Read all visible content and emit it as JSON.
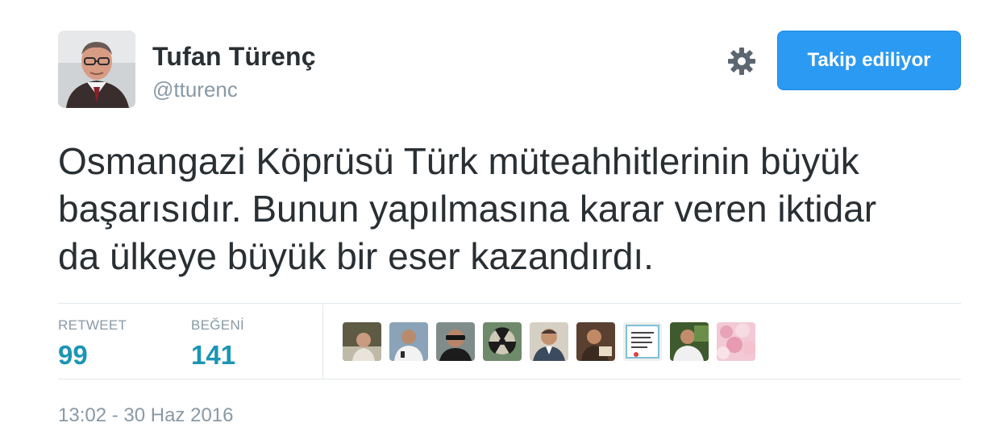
{
  "author": {
    "name": "Tufan Türenç",
    "handle": "@tturenc",
    "avatar_icon": "person-photo-avatar"
  },
  "actions": {
    "settings_icon": "gear-icon",
    "follow_label": "Takip ediliyor",
    "follow_color": "#2b9af3"
  },
  "tweet": {
    "text": "Osmangazi Köprüsü Türk müteahhitlerinin büyük\nbaşarısıdır. Bunun yapılmasına karar veren iktidar\nda ülkeye büyük bir eser kazandırdı."
  },
  "stats": {
    "retweet_label": "RETWEET",
    "retweet_count": "99",
    "like_label": "BEĞENİ",
    "like_count": "141",
    "count_color": "#1b95b4"
  },
  "likers_count_shown": 9,
  "timestamp": "13:02 - 30 Haz 2016"
}
